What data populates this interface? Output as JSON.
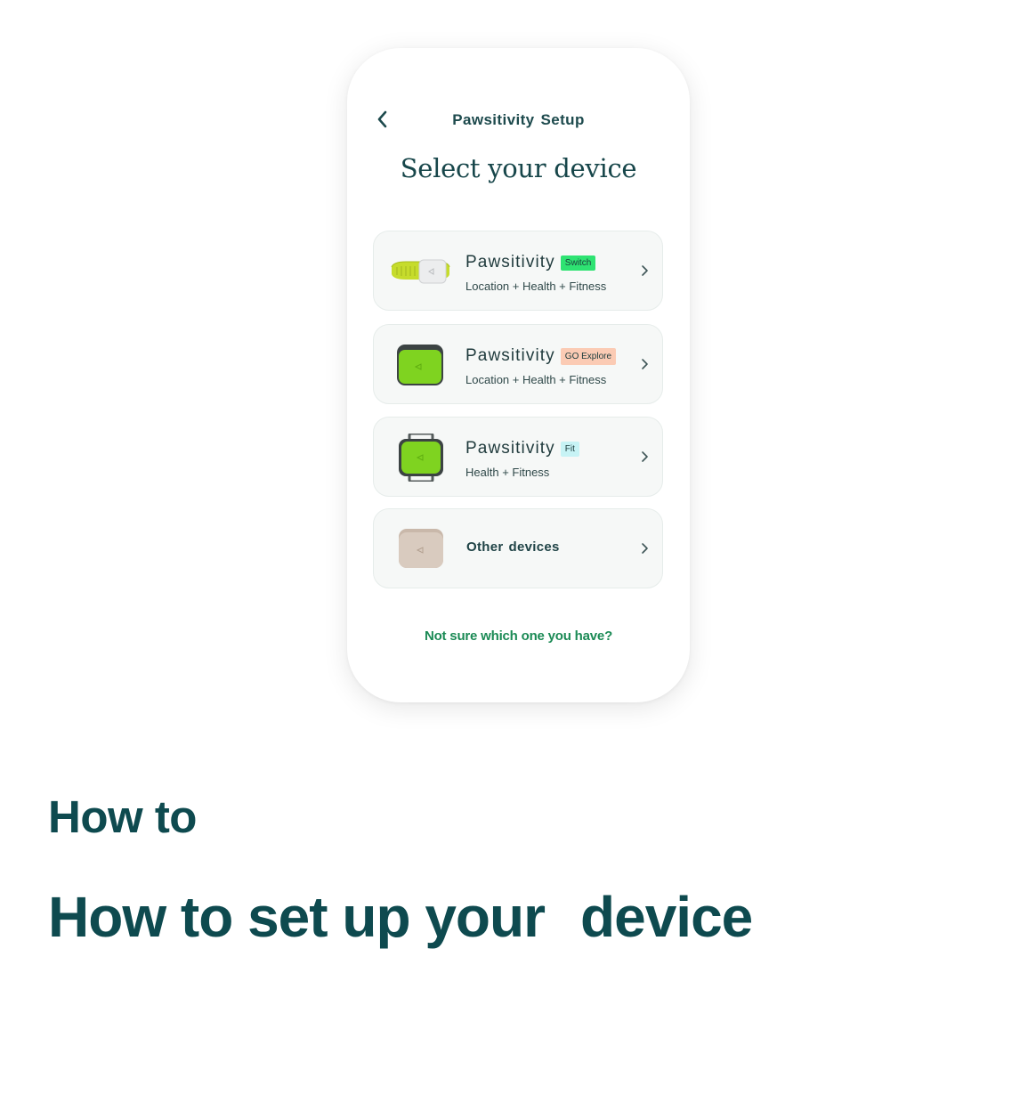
{
  "app": {
    "header_word1": "Pawsitivity",
    "header_word2": "Setup",
    "heading": "Select your device"
  },
  "devices": [
    {
      "name": "Pawsitivity",
      "badge": "Switch",
      "badge_color": "#2ee372",
      "features": "Location + Health + Fitness"
    },
    {
      "name": "Pawsitivity",
      "badge": "GO Explore",
      "badge_color": "#fbcbb4",
      "features": "Location + Health + Fitness"
    },
    {
      "name": "Pawsitivity",
      "badge": "Fit",
      "badge_color": "#c7f3f5",
      "features": "Health + Fitness"
    }
  ],
  "other_devices": {
    "word1": "Other",
    "word2": "devices"
  },
  "help_link": "Not sure which one you have?",
  "article": {
    "label": "How to",
    "title_part1": "How to set up your",
    "title_part2": "device"
  },
  "colors": {
    "brand_dark": "#0e4a4f",
    "link_green": "#1b8a55",
    "device_green": "#7fd320"
  },
  "icons": {
    "back": "chevron-left-icon",
    "row_arrow": "chevron-right-icon"
  }
}
